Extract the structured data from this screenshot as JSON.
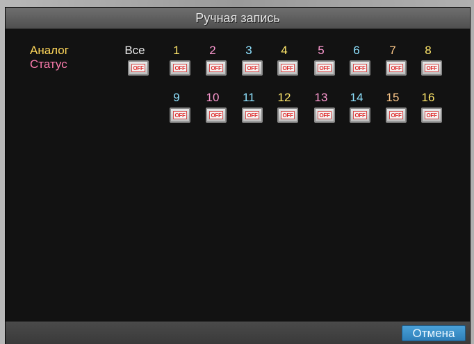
{
  "window": {
    "title": "Ручная запись"
  },
  "labels": {
    "analog": "Аналог",
    "status": "Статус"
  },
  "all": {
    "label": "Все",
    "state": "OFF"
  },
  "channels_row1": [
    {
      "label": "1",
      "state": "OFF"
    },
    {
      "label": "2",
      "state": "OFF"
    },
    {
      "label": "3",
      "state": "OFF"
    },
    {
      "label": "4",
      "state": "OFF"
    },
    {
      "label": "5",
      "state": "OFF"
    },
    {
      "label": "6",
      "state": "OFF"
    },
    {
      "label": "7",
      "state": "OFF"
    },
    {
      "label": "8",
      "state": "OFF"
    }
  ],
  "channels_row2": [
    {
      "label": "9",
      "state": "OFF"
    },
    {
      "label": "10",
      "state": "OFF"
    },
    {
      "label": "11",
      "state": "OFF"
    },
    {
      "label": "12",
      "state": "OFF"
    },
    {
      "label": "13",
      "state": "OFF"
    },
    {
      "label": "14",
      "state": "OFF"
    },
    {
      "label": "15",
      "state": "OFF"
    },
    {
      "label": "16",
      "state": "OFF"
    }
  ],
  "footer": {
    "cancel_label": "Отмена"
  },
  "colors": {
    "title_bg": "#5f5f5f",
    "panel_bg": "#121212",
    "analog_label": "#ffd75a",
    "status_label": "#ff7db0",
    "off_text": "#e02d2d",
    "cancel_bg": "#3a8dc8"
  }
}
